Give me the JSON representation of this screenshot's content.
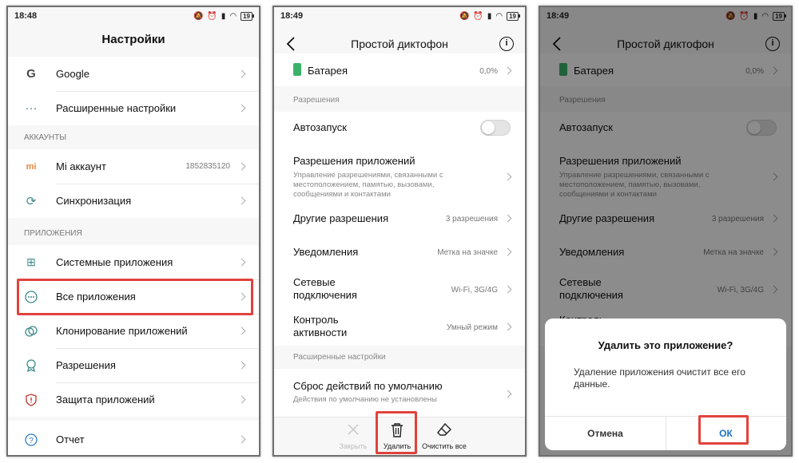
{
  "phone1": {
    "time": "18:48",
    "battery": "19",
    "title": "Настройки",
    "rows_top": [
      {
        "label": "Google",
        "icon": "google-icon"
      },
      {
        "label": "Расширенные настройки",
        "icon": "more-dots-icon"
      }
    ],
    "section_accounts": "АККАУНТЫ",
    "rows_accounts": [
      {
        "label": "Mi аккаунт",
        "value": "1852835120",
        "icon": "mi-icon"
      },
      {
        "label": "Синхронизация",
        "icon": "sync-icon"
      }
    ],
    "section_apps": "ПРИЛОЖЕНИЯ",
    "rows_apps": [
      {
        "label": "Системные приложения",
        "icon": "grid-icon"
      },
      {
        "label": "Все приложения",
        "icon": "dots-circle-icon"
      },
      {
        "label": "Клонирование приложений",
        "icon": "clone-icon"
      },
      {
        "label": "Разрешения",
        "icon": "badge-icon"
      },
      {
        "label": "Защита приложений",
        "icon": "shield-icon"
      }
    ],
    "rows_bottom": [
      {
        "label": "Отчет",
        "icon": "question-icon"
      }
    ]
  },
  "phone2": {
    "time": "18:49",
    "battery": "19",
    "title": "Простой диктофон",
    "battery_row": {
      "label": "Батарея",
      "value": "0,0%"
    },
    "section_permissions": "Разрешения",
    "autostart": "Автозапуск",
    "app_permissions": {
      "label": "Разрешения приложений",
      "sub": "Управление разрешениями, связанными с местоположением, памятью, вызовами, сообщениями и контактами"
    },
    "other_permissions": {
      "label": "Другие разрешения",
      "value": "3 разрешения"
    },
    "notifications": {
      "label": "Уведомления",
      "value": "Метка на значке"
    },
    "network": {
      "label": "Сетевые подключения",
      "value": "Wi-Fi, 3G/4G"
    },
    "activity": {
      "label": "Контроль активности",
      "value": "Умный режим"
    },
    "section_advanced": "Расширенные настройки",
    "reset": {
      "label": "Сброс действий по умолчанию",
      "sub": "Действия по умолчанию не установлены"
    },
    "bottom": {
      "close": "Закрыть",
      "delete": "Удалить",
      "clear": "Очистить все"
    }
  },
  "phone3": {
    "time": "18:49",
    "battery": "19",
    "dialog": {
      "title": "Удалить это приложение?",
      "message": "Удаление приложения очистит все его данные.",
      "cancel": "Отмена",
      "ok": "ОК"
    }
  },
  "colors": {
    "highlight": "#e0423c",
    "battery_green": "#3bb26b"
  }
}
